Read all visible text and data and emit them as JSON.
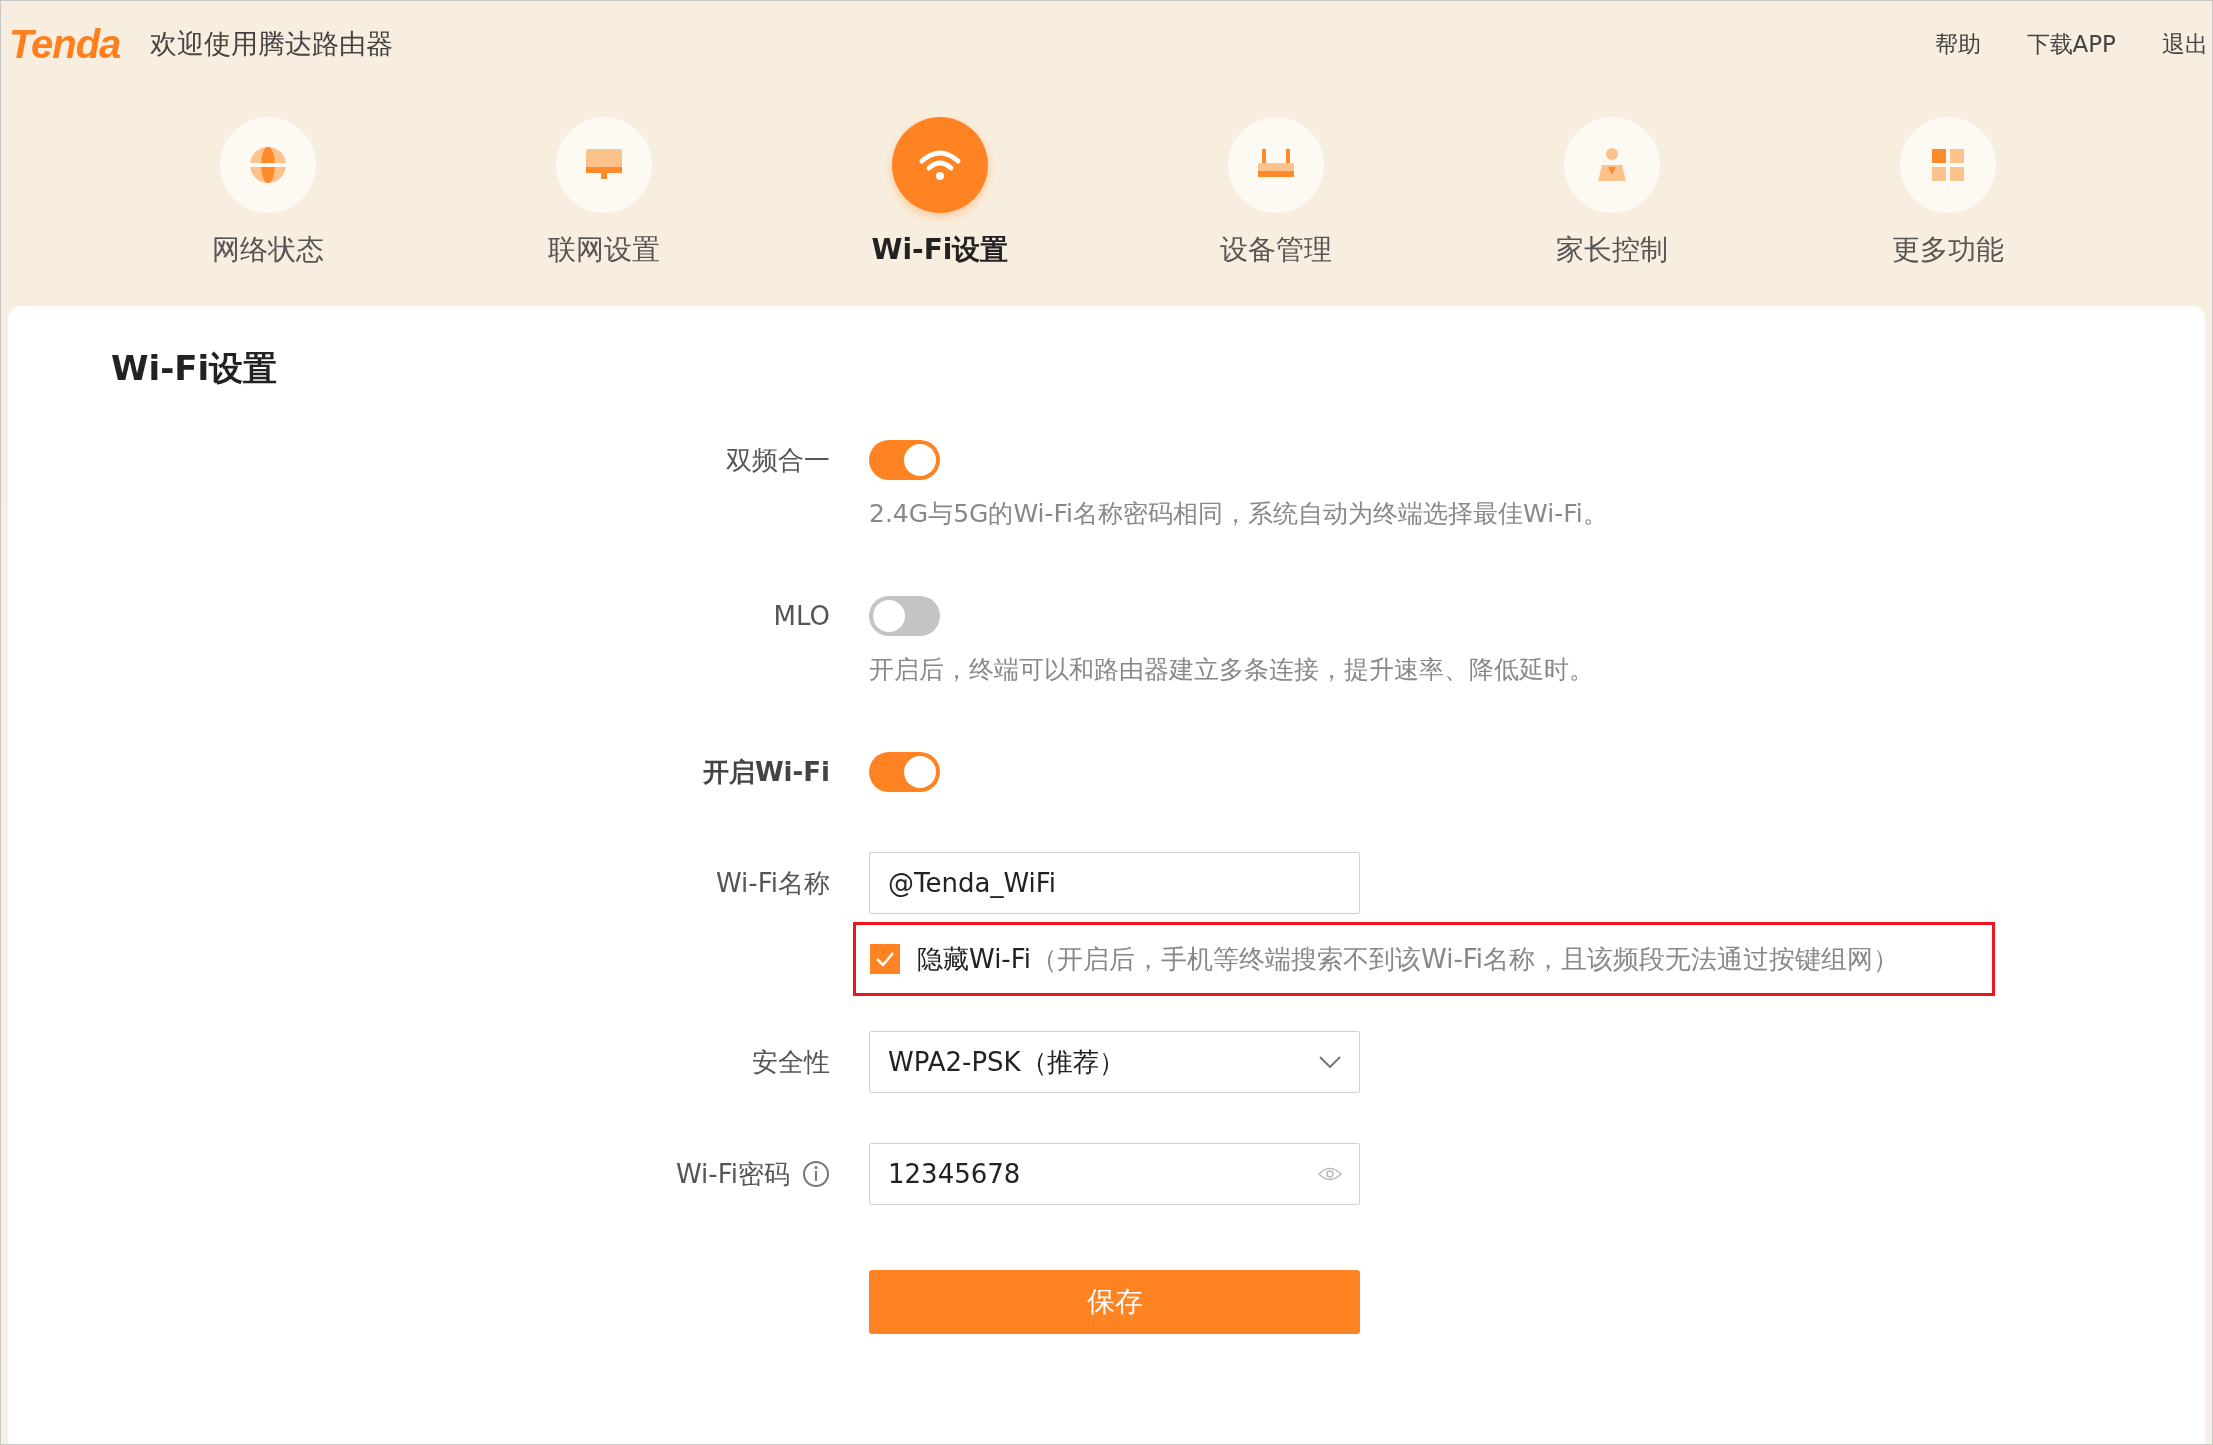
{
  "header": {
    "logo": "Tenda",
    "welcome": "欢迎使用腾达路由器",
    "links": [
      "帮助",
      "下载APP",
      "退出"
    ]
  },
  "nav": [
    {
      "label": "网络状态",
      "selected": false
    },
    {
      "label": "联网设置",
      "selected": false
    },
    {
      "label": "Wi-Fi设置",
      "selected": true
    },
    {
      "label": "设备管理",
      "selected": false
    },
    {
      "label": "家长控制",
      "selected": false
    },
    {
      "label": "更多功能",
      "selected": false
    }
  ],
  "page_title": "Wi-Fi设置",
  "settings": [
    {
      "kind": "toggle",
      "label": "双频合一",
      "bold": false,
      "on": true,
      "description": "2.4G与5G的Wi-Fi名称密码相同，系统自动为终端选择最佳Wi-Fi。"
    },
    {
      "kind": "toggle",
      "label": "MLO",
      "bold": false,
      "on": false,
      "description": "开启后，终端可以和路由器建立多条连接，提升速率、降低延时。"
    },
    {
      "kind": "toggle",
      "label": "开启Wi-Fi",
      "bold": true,
      "on": true
    },
    {
      "kind": "text",
      "label": "Wi-Fi名称",
      "value": "@Tenda_WiFi",
      "option": {
        "checked": true,
        "highlighted": true,
        "label": "隐藏Wi-Fi",
        "note": "（开启后，手机等终端搜索不到该Wi-Fi名称，且该频段无法通过按键组网）"
      }
    },
    {
      "kind": "select",
      "label": "安全性",
      "value": "WPA2-PSK（推荐）"
    },
    {
      "kind": "password",
      "label": "Wi-Fi密码",
      "info": true,
      "value": "12345678"
    }
  ],
  "save_button": "保存"
}
